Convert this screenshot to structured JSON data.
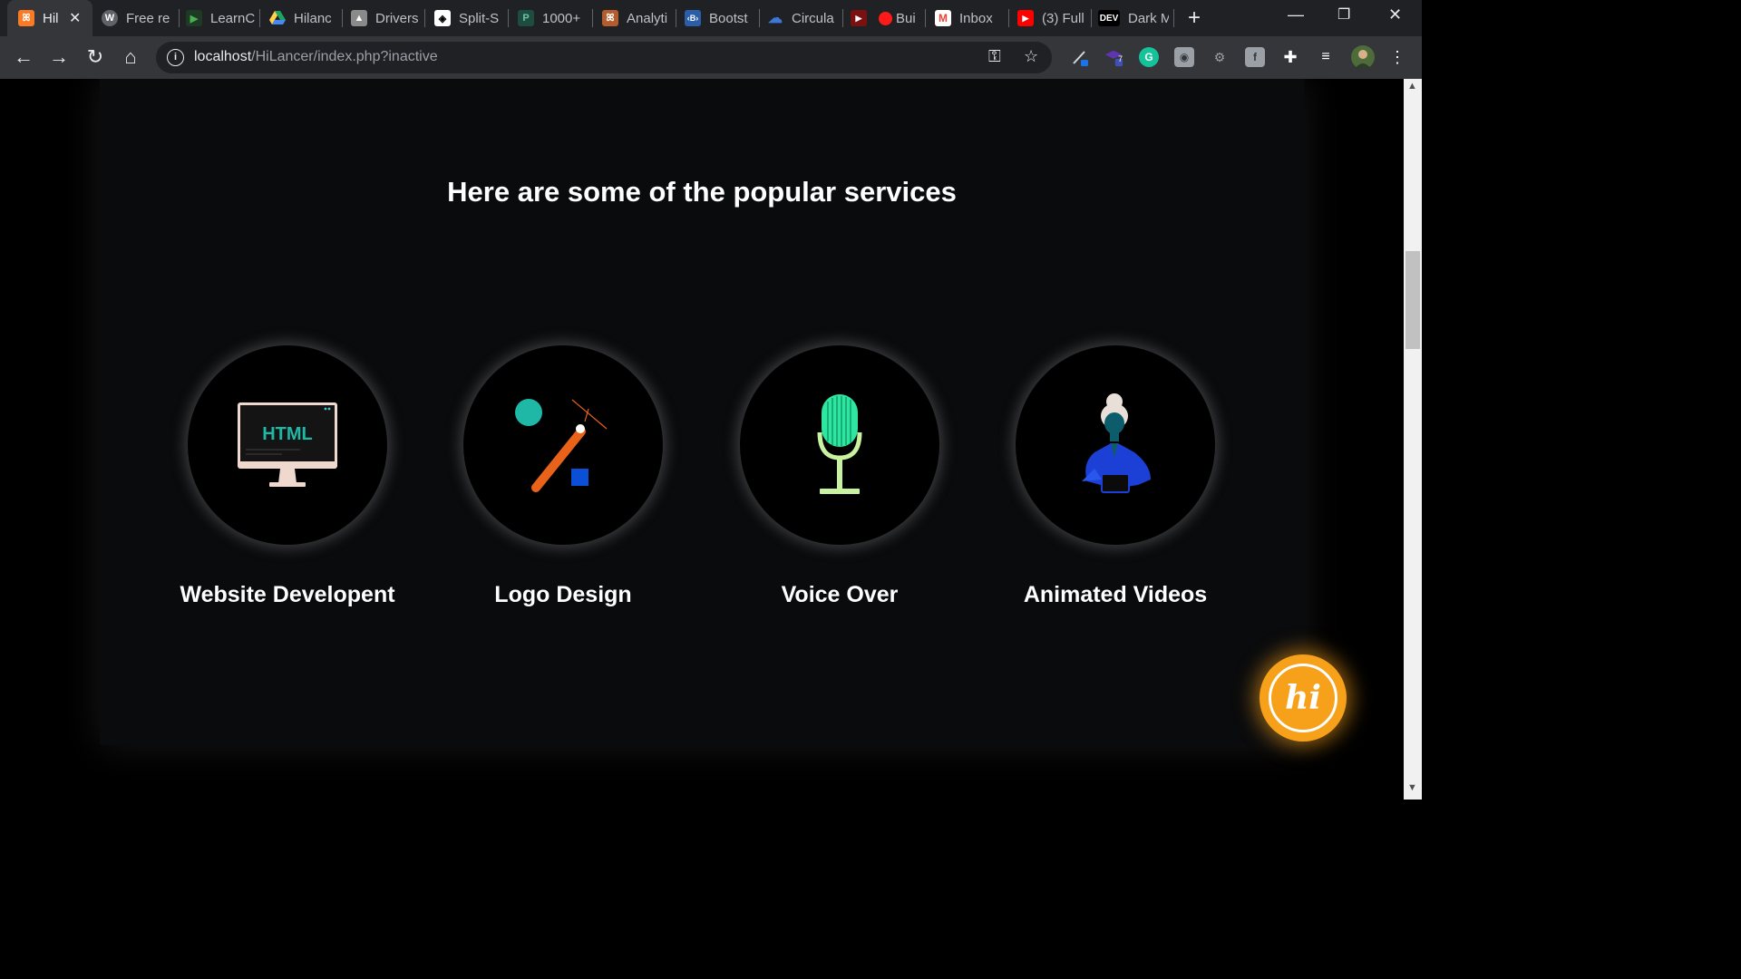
{
  "browser": {
    "tabs": [
      {
        "label": "Hil",
        "active": true,
        "icon": "xampp-icon",
        "color": "#fb7a24"
      },
      {
        "label": "Free re",
        "icon": "wordpress-icon",
        "color": "#5f6368"
      },
      {
        "label": "LearnC",
        "icon": "learncode-icon",
        "color": "#2e7d32"
      },
      {
        "label": "Hilanc",
        "icon": "google-drive-icon",
        "color": "#1fa463"
      },
      {
        "label": "Drivers",
        "icon": "drivers-icon",
        "color": "#8a8a8a"
      },
      {
        "label": "Split-S",
        "icon": "codepen-icon",
        "color": "#ffffff"
      },
      {
        "label": "1000+",
        "icon": "freepik-icon",
        "color": "#1c7a5e"
      },
      {
        "label": "Analyti",
        "icon": "xampp-icon",
        "color": "#b45c2e"
      },
      {
        "label": "Bootst",
        "icon": "bootstrap-icon",
        "color": "#2a5ea8"
      },
      {
        "label": "Circula",
        "icon": "cloud-icon",
        "color": "#3c78d8"
      },
      {
        "label": "",
        "icon": "youtube-icon",
        "color": "#cc0000"
      },
      {
        "label": "Bui",
        "icon": "record-icon",
        "color": "#ff1a1a"
      },
      {
        "label": "Inbox",
        "icon": "gmail-icon",
        "color": "#ea4335"
      },
      {
        "label": "(3) Full",
        "icon": "youtube-icon",
        "color": "#ff0000"
      },
      {
        "label": "Dark M",
        "icon": "dev-icon",
        "color": "#000000",
        "icon_text": "DEV"
      }
    ],
    "new_tab": "+",
    "url_host": "localhost",
    "url_path": "/HiLancer/index.php?inactive",
    "extension_badge": "7"
  },
  "page": {
    "heading": "Here are some of the popular services",
    "services": [
      {
        "title": "Website Developent",
        "icon": "html-monitor-icon",
        "screen_text": "HTML"
      },
      {
        "title": "Logo Design",
        "icon": "logo-design-icon"
      },
      {
        "title": "Voice Over",
        "icon": "microphone-icon"
      },
      {
        "title": "Animated Videos",
        "icon": "animated-person-icon"
      }
    ],
    "chat_label": "hi"
  },
  "colors": {
    "accent_orange": "#f7a11a",
    "teal": "#1fb8a6",
    "mic_green": "#2ee6a0",
    "logo_orange": "#e8621a",
    "logo_blue": "#0a4fd6"
  }
}
